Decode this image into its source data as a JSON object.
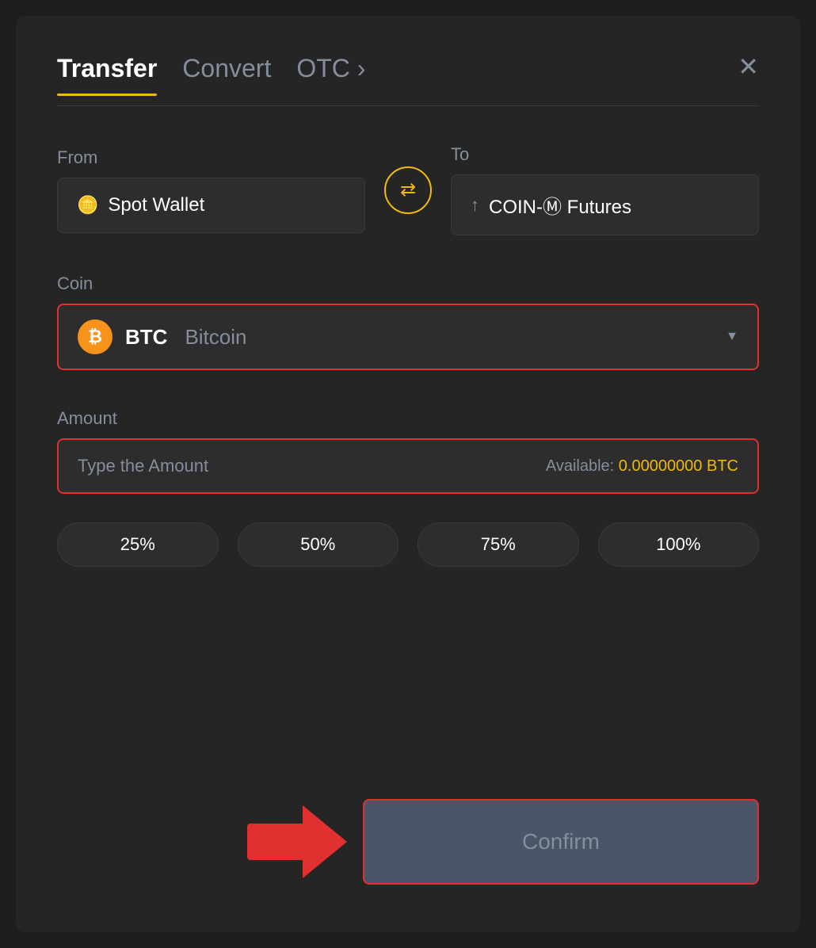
{
  "modal": {
    "title": "Transfer"
  },
  "tabs": [
    {
      "label": "Transfer",
      "active": true
    },
    {
      "label": "Convert",
      "active": false
    },
    {
      "label": "OTC ›",
      "active": false
    }
  ],
  "from": {
    "label": "From",
    "wallet": "Spot Wallet",
    "icon": "💳"
  },
  "to": {
    "label": "To",
    "wallet": "COIN-Ⓜ Futures",
    "icon": "↑"
  },
  "coin": {
    "label": "Coin",
    "symbol": "BTC",
    "name": "Bitcoin"
  },
  "amount": {
    "label": "Amount",
    "placeholder": "Type the Amount",
    "available_label": "Available:",
    "available_value": "0.00000000 BTC"
  },
  "percentages": [
    "25%",
    "50%",
    "75%",
    "100%"
  ],
  "confirm": {
    "label": "Confirm"
  }
}
